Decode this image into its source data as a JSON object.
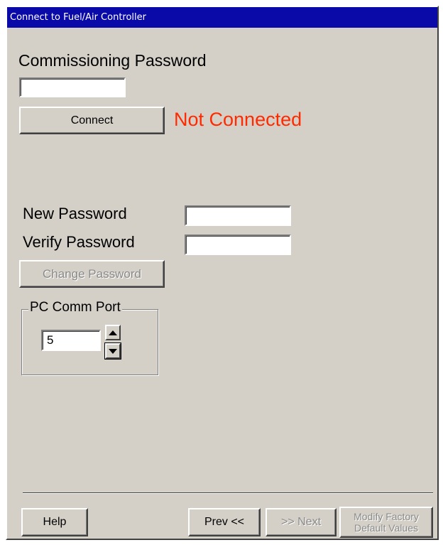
{
  "window": {
    "title": "Connect to Fuel/Air Controller"
  },
  "commissioning": {
    "label": "Commissioning Password",
    "password_value": "",
    "connect_label": "Connect",
    "status_text": "Not Connected",
    "status_color": "#ff2a00"
  },
  "change_password": {
    "new_label": "New Password",
    "new_value": "",
    "verify_label": "Verify Password",
    "verify_value": "",
    "button_label": "Change Password"
  },
  "comm_port": {
    "group_title": "PC Comm Port",
    "value": "5",
    "up_icon": "triangle-up-icon",
    "down_icon": "triangle-down-icon"
  },
  "footer": {
    "help_label": "Help",
    "prev_label": "Prev <<",
    "next_label": ">> Next",
    "modify_line1": "Modify Factory",
    "modify_line2": "Default Values"
  }
}
